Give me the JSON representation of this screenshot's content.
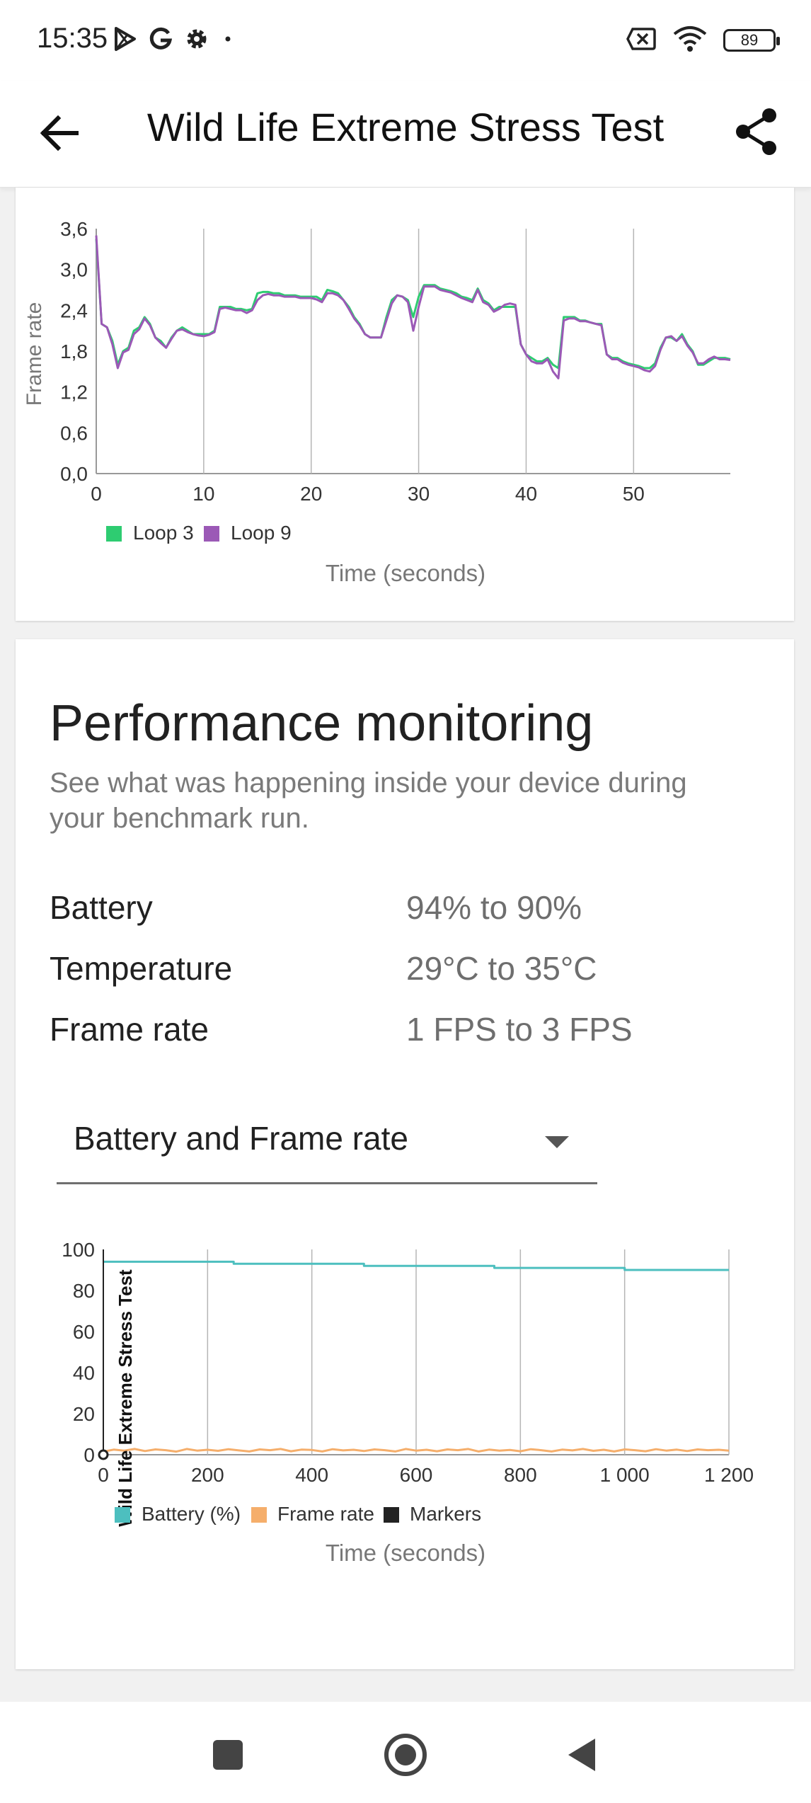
{
  "status_bar": {
    "time": "15:35",
    "left_icons": [
      "play-store-icon",
      "google-icon",
      "settings-icon",
      "dot-icon"
    ],
    "right_icons": [
      "no-sim-icon",
      "wifi-icon",
      "battery-icon"
    ],
    "battery_level": "89"
  },
  "app_bar": {
    "title": "Wild Life Extreme Stress Test",
    "back_icon": "arrow-left-icon",
    "share_icon": "share-icon"
  },
  "frame_rate_chart": {
    "ylabel": "Frame rate",
    "xlabel": "Time (seconds)",
    "y_ticks": [
      "0,0",
      "0,6",
      "1,2",
      "1,8",
      "2,4",
      "3,0",
      "3,6"
    ],
    "x_ticks": [
      "0",
      "10",
      "20",
      "30",
      "40",
      "50"
    ],
    "legend": [
      {
        "label": "Loop 3",
        "color": "#2ecc71"
      },
      {
        "label": "Loop 9",
        "color": "#9b59b6"
      }
    ]
  },
  "performance": {
    "title": "Performance monitoring",
    "description": "See what was happening inside your device during your benchmark run.",
    "stats": [
      {
        "label": "Battery",
        "value": "94% to 90%"
      },
      {
        "label": "Temperature",
        "value": "29°C to 35°C"
      },
      {
        "label": "Frame rate",
        "value": "1 FPS to 3 FPS"
      }
    ],
    "dropdown_value": "Battery and Frame rate"
  },
  "monitor_chart": {
    "xlabel": "Time (seconds)",
    "marker_label": "Wild Life Extreme Stress Test",
    "y_ticks": [
      "0",
      "20",
      "40",
      "60",
      "80",
      "100"
    ],
    "x_ticks": [
      "0",
      "200",
      "400",
      "600",
      "800",
      "1 000",
      "1 200"
    ],
    "legend": [
      {
        "label": "Battery (%)",
        "color": "#4dbfbf"
      },
      {
        "label": "Frame rate",
        "color": "#f5ae6b"
      },
      {
        "label": "Markers",
        "color": "#222222"
      }
    ]
  },
  "chart_data": [
    {
      "type": "line",
      "xlabel": "Time (seconds)",
      "ylabel": "Frame rate",
      "xlim": [
        0,
        59
      ],
      "ylim": [
        0,
        3.6
      ],
      "grid": "vertical",
      "legend_position": "bottom-left",
      "series": [
        {
          "name": "Loop 3",
          "color": "#2ecc71",
          "x": [
            0,
            0.5,
            1,
            1.5,
            2,
            2.5,
            3,
            3.5,
            4,
            4.5,
            5,
            5.5,
            6,
            6.5,
            7,
            7.5,
            8,
            8.5,
            9,
            9.5,
            10,
            10.5,
            11,
            11.5,
            12,
            12.5,
            13,
            13.5,
            14,
            14.5,
            15,
            15.5,
            16,
            16.5,
            17,
            17.5,
            18,
            18.5,
            19,
            19.5,
            20,
            20.5,
            21,
            21.5,
            22,
            22.5,
            23,
            23.5,
            24,
            24.5,
            25,
            25.5,
            26,
            26.5,
            27,
            27.5,
            28,
            28.5,
            29,
            29.5,
            30,
            30.5,
            31,
            31.5,
            32,
            32.5,
            33,
            33.5,
            34,
            34.5,
            35,
            35.5,
            36,
            36.5,
            37,
            37.5,
            38,
            38.5,
            39,
            39.5,
            40,
            40.5,
            41,
            41.5,
            42,
            42.5,
            43,
            43.5,
            44,
            44.5,
            45,
            45.5,
            46,
            46.5,
            47,
            47.5,
            48,
            48.5,
            49,
            49.5,
            50,
            50.5,
            51,
            51.5,
            52,
            52.5,
            53,
            53.5,
            54,
            54.5,
            55,
            55.5,
            56,
            56.5,
            57,
            57.5,
            58,
            58.5,
            59
          ],
          "values": [
            3.45,
            2.2,
            2.15,
            1.95,
            1.6,
            1.8,
            1.85,
            2.1,
            2.15,
            2.3,
            2.2,
            2.0,
            1.95,
            1.85,
            2.0,
            2.1,
            2.15,
            2.1,
            2.05,
            2.05,
            2.05,
            2.05,
            2.1,
            2.45,
            2.45,
            2.45,
            2.42,
            2.42,
            2.4,
            2.42,
            2.65,
            2.67,
            2.67,
            2.65,
            2.65,
            2.62,
            2.62,
            2.62,
            2.6,
            2.6,
            2.6,
            2.6,
            2.55,
            2.7,
            2.68,
            2.65,
            2.55,
            2.45,
            2.3,
            2.2,
            2.05,
            2.0,
            2.0,
            2.0,
            2.3,
            2.55,
            2.62,
            2.6,
            2.55,
            2.3,
            2.6,
            2.77,
            2.77,
            2.77,
            2.72,
            2.7,
            2.68,
            2.65,
            2.6,
            2.58,
            2.55,
            2.72,
            2.55,
            2.5,
            2.4,
            2.45,
            2.45,
            2.45,
            2.45,
            1.9,
            1.75,
            1.7,
            1.65,
            1.65,
            1.7,
            1.6,
            1.55,
            2.3,
            2.3,
            2.3,
            2.25,
            2.25,
            2.22,
            2.2,
            2.2,
            1.75,
            1.7,
            1.7,
            1.65,
            1.62,
            1.6,
            1.58,
            1.55,
            1.55,
            1.62,
            1.85,
            2.0,
            2.0,
            1.95,
            2.05,
            1.9,
            1.8,
            1.6,
            1.6,
            1.65,
            1.7,
            1.7,
            1.7,
            1.68
          ],
          "note_comment": ""
        },
        {
          "name": "Loop 9",
          "color": "#9b59b6",
          "x": [
            0,
            0.5,
            1,
            1.5,
            2,
            2.5,
            3,
            3.5,
            4,
            4.5,
            5,
            5.5,
            6,
            6.5,
            7,
            7.5,
            8,
            8.5,
            9,
            9.5,
            10,
            10.5,
            11,
            11.5,
            12,
            12.5,
            13,
            13.5,
            14,
            14.5,
            15,
            15.5,
            16,
            16.5,
            17,
            17.5,
            18,
            18.5,
            19,
            19.5,
            20,
            20.5,
            21,
            21.5,
            22,
            22.5,
            23,
            23.5,
            24,
            24.5,
            25,
            25.5,
            26,
            26.5,
            27,
            27.5,
            28,
            28.5,
            29,
            29.5,
            30,
            30.5,
            31,
            31.5,
            32,
            32.5,
            33,
            33.5,
            34,
            34.5,
            35,
            35.5,
            36,
            36.5,
            37,
            37.5,
            38,
            38.5,
            39,
            39.5,
            40,
            40.5,
            41,
            41.5,
            42,
            42.5,
            43,
            43.5,
            44,
            44.5,
            45,
            45.5,
            46,
            46.5,
            47,
            47.5,
            48,
            48.5,
            49,
            49.5,
            50,
            50.5,
            51,
            51.5,
            52,
            52.5,
            53,
            53.5,
            54,
            54.5,
            55,
            55.5,
            56,
            56.5,
            57,
            57.5,
            58,
            58.5,
            59
          ],
          "values": [
            3.5,
            2.2,
            2.15,
            1.9,
            1.55,
            1.78,
            1.82,
            2.05,
            2.12,
            2.28,
            2.18,
            2.0,
            1.92,
            1.85,
            1.98,
            2.1,
            2.12,
            2.08,
            2.05,
            2.03,
            2.02,
            2.04,
            2.08,
            2.42,
            2.44,
            2.42,
            2.4,
            2.4,
            2.36,
            2.4,
            2.55,
            2.62,
            2.64,
            2.62,
            2.62,
            2.6,
            2.6,
            2.6,
            2.58,
            2.58,
            2.58,
            2.56,
            2.52,
            2.65,
            2.65,
            2.62,
            2.55,
            2.42,
            2.28,
            2.18,
            2.05,
            2.0,
            2.0,
            2.0,
            2.25,
            2.5,
            2.62,
            2.6,
            2.52,
            2.1,
            2.45,
            2.75,
            2.75,
            2.75,
            2.7,
            2.68,
            2.66,
            2.62,
            2.58,
            2.55,
            2.52,
            2.7,
            2.52,
            2.48,
            2.38,
            2.42,
            2.48,
            2.5,
            2.48,
            1.9,
            1.75,
            1.65,
            1.62,
            1.62,
            1.68,
            1.5,
            1.4,
            2.25,
            2.28,
            2.28,
            2.24,
            2.24,
            2.22,
            2.2,
            2.18,
            1.75,
            1.68,
            1.68,
            1.63,
            1.6,
            1.58,
            1.56,
            1.52,
            1.5,
            1.58,
            1.82,
            2.0,
            2.02,
            1.95,
            2.02,
            1.88,
            1.78,
            1.62,
            1.62,
            1.68,
            1.72,
            1.68,
            1.68,
            1.67
          ]
        }
      ]
    },
    {
      "type": "line",
      "xlabel": "Time (seconds)",
      "ylabel": "",
      "xlim": [
        0,
        1200
      ],
      "ylim": [
        0,
        100
      ],
      "grid": "vertical",
      "legend_position": "bottom-left",
      "series": [
        {
          "name": "Battery (%)",
          "color": "#4dbfbf",
          "x": [
            0,
            250,
            250,
            500,
            500,
            750,
            750,
            1000,
            1000,
            1200
          ],
          "values": [
            94,
            94,
            93,
            93,
            92,
            92,
            91,
            91,
            90,
            90
          ]
        },
        {
          "name": "Frame rate",
          "color": "#f5ae6b",
          "x": [
            0,
            20,
            40,
            60,
            80,
            100,
            120,
            140,
            160,
            180,
            200,
            220,
            240,
            260,
            280,
            300,
            320,
            340,
            360,
            380,
            400,
            420,
            440,
            460,
            480,
            500,
            520,
            540,
            560,
            580,
            600,
            620,
            640,
            660,
            680,
            700,
            720,
            740,
            760,
            780,
            800,
            820,
            840,
            860,
            880,
            900,
            920,
            940,
            960,
            980,
            1000,
            1020,
            1040,
            1060,
            1080,
            1100,
            1120,
            1140,
            1160,
            1180,
            1200
          ],
          "values": [
            1.5,
            2.5,
            2,
            2.8,
            1.8,
            2.6,
            2.2,
            1.5,
            2.8,
            2,
            2.4,
            1.9,
            2.7,
            2.1,
            1.6,
            2.6,
            2.2,
            2.8,
            1.7,
            2.5,
            2.3,
            1.6,
            2.7,
            2.1,
            2.4,
            1.8,
            2.6,
            2.2,
            1.6,
            2.8,
            2,
            2.4,
            1.7,
            2.6,
            2.2,
            2.8,
            1.6,
            2.5,
            2,
            2.3,
            1.7,
            2.7,
            2.2,
            1.6,
            2.5,
            2.1,
            2.8,
            1.9,
            2.4,
            1.6,
            2.6,
            2.2,
            1.7,
            2.7,
            2,
            2.5,
            1.8,
            2.6,
            2.2,
            2.4,
            2
          ]
        },
        {
          "name": "Markers",
          "color": "#222222",
          "x": [
            0,
            0
          ],
          "values": [
            0,
            100
          ],
          "label": "Wild Life Extreme Stress Test"
        }
      ]
    }
  ]
}
